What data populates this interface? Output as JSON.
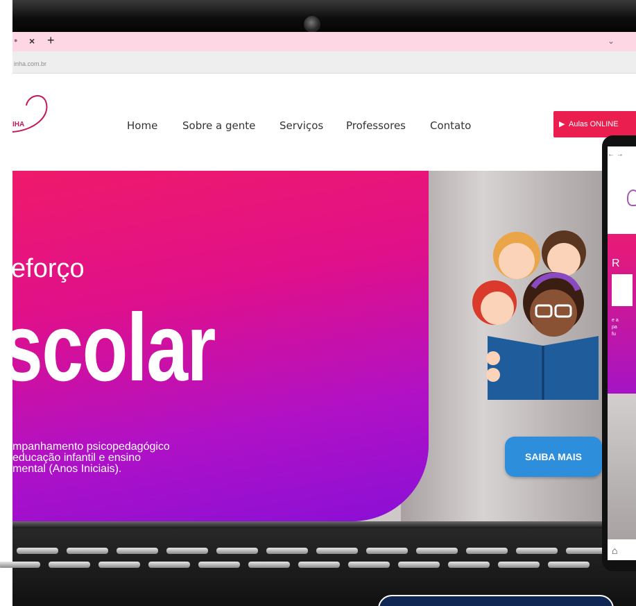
{
  "browser": {
    "tab_partial": "● ",
    "tab_close": "×",
    "tab_new": "+",
    "tab_menu": "⌄",
    "url": "inha.com.br"
  },
  "site": {
    "logo_text": "IHA",
    "nav": [
      "Home",
      "Sobre a gente",
      "Serviços",
      "Professores",
      "Contato"
    ],
    "cta_online": "Aulas ONLINE",
    "hero_small": "eforço",
    "hero_big": "scolar",
    "hero_desc_lines": [
      "mpanhamento psicopedagógico",
      "educação infantil e ensino",
      "mental (Anos Iniciais)."
    ],
    "saiba_mais": "SAIBA MAIS"
  },
  "phone": {
    "nav": "← →",
    "hero_letter": "R",
    "hero_text_lines": [
      "e a",
      "pa",
      "fu"
    ],
    "home_icon": "⌂"
  },
  "colors": {
    "gradient_top": "#ef1a6a",
    "gradient_bottom": "#8a0fd6",
    "cta_red": "#ea1f4f",
    "saiba_blue": "#2d8fdc",
    "tabbar_pink": "#fdd7e4"
  }
}
